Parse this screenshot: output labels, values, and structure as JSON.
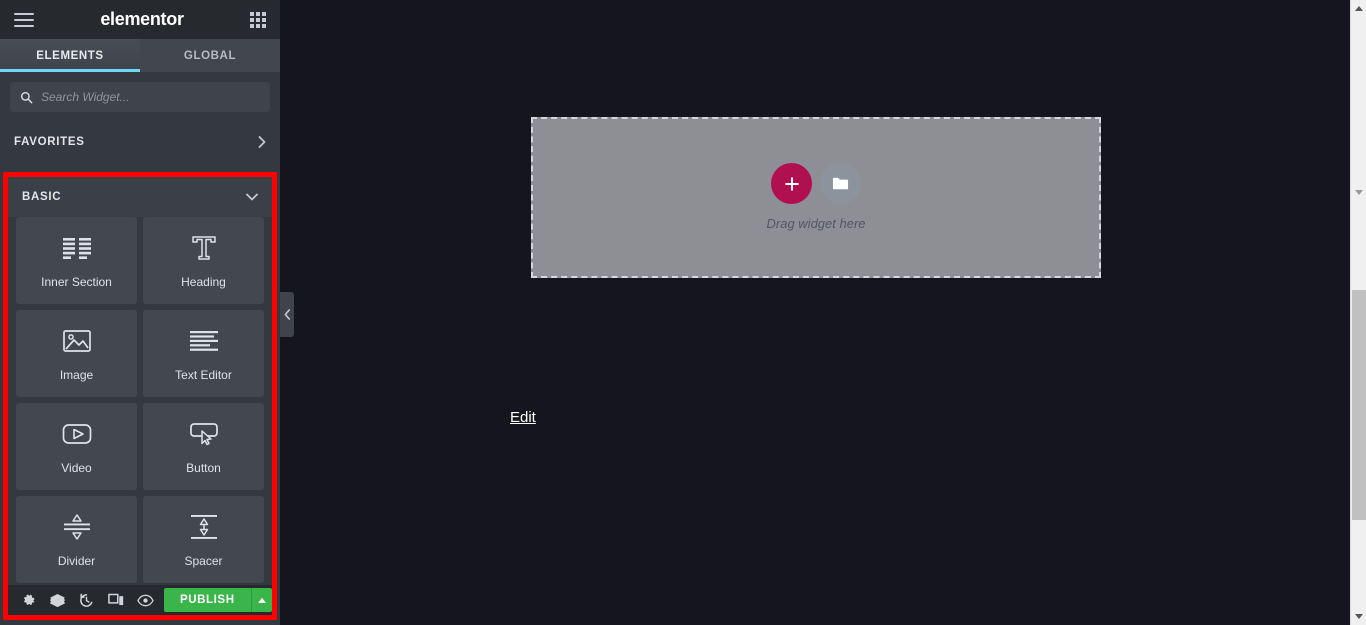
{
  "panel": {
    "header": {
      "menu_icon": "hamburger-icon",
      "logo": "elementor",
      "apps_icon": "grid-apps-icon"
    },
    "tabs": [
      {
        "label": "ELEMENTS",
        "active": true
      },
      {
        "label": "GLOBAL",
        "active": false
      }
    ],
    "search": {
      "icon": "search-icon",
      "placeholder": "Search Widget...",
      "value": ""
    },
    "sections": [
      {
        "label": "FAVORITES",
        "chevron": "chevron-right-icon",
        "expanded": false
      },
      {
        "label": "BASIC",
        "chevron": "chevron-down-icon",
        "expanded": true
      }
    ],
    "widgets": [
      {
        "label": "Inner Section",
        "icon": "columns-icon"
      },
      {
        "label": "Heading",
        "icon": "heading-t-icon"
      },
      {
        "label": "Image",
        "icon": "image-icon"
      },
      {
        "label": "Text Editor",
        "icon": "text-lines-icon"
      },
      {
        "label": "Video",
        "icon": "video-play-icon"
      },
      {
        "label": "Button",
        "icon": "button-cursor-icon"
      },
      {
        "label": "Divider",
        "icon": "divider-icon"
      },
      {
        "label": "Spacer",
        "icon": "spacer-icon"
      }
    ],
    "bottom_bar": {
      "tools": [
        {
          "name": "settings-icon",
          "title": "Settings"
        },
        {
          "name": "layers-icon",
          "title": "Navigator"
        },
        {
          "name": "history-icon",
          "title": "History"
        },
        {
          "name": "responsive-icon",
          "title": "Responsive Mode"
        },
        {
          "name": "preview-eye-icon",
          "title": "Preview Changes"
        }
      ],
      "publish_label": "PUBLISH",
      "publish_arrow": "▲",
      "publish_color": "#39b54a"
    },
    "collapse_handle": "‹"
  },
  "canvas": {
    "dropzone": {
      "add_icon": "+",
      "folder_icon": "folder-icon",
      "text": "Drag widget here"
    },
    "edit_link": "Edit"
  },
  "annotation": {
    "highlight_color": "#fe0000"
  },
  "scrollbar": {
    "up_arrow": "scroll-up-arrow",
    "down_arrow": "scroll-down-arrow",
    "thumb": "scroll-thumb"
  }
}
